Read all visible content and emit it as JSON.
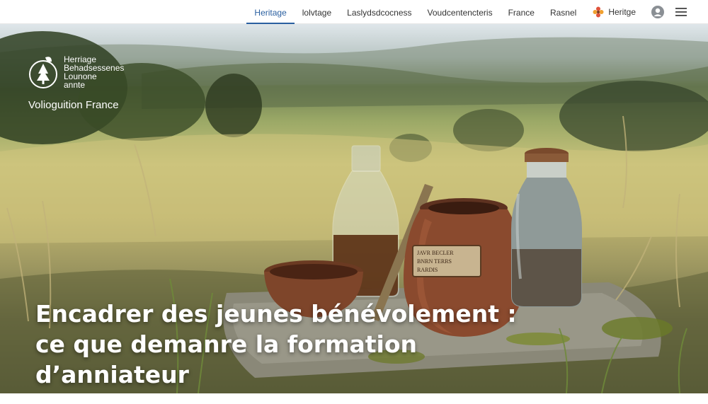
{
  "nav": {
    "items": [
      {
        "label": "Heritage",
        "active": true
      },
      {
        "label": "lolvtage"
      },
      {
        "label": "Laslydsdcocness"
      },
      {
        "label": "Voudcentencteris"
      },
      {
        "label": "France"
      },
      {
        "label": "Rasnel"
      }
    ],
    "brand_label": "Heritge",
    "icons": [
      "flower-icon",
      "user-icon",
      "menu-icon"
    ]
  },
  "logo": {
    "line1": "Herriage",
    "line2": "Behadsessenes",
    "line3": "Lounone",
    "line4": "annte",
    "tagline": "Volioguition France"
  },
  "hero": {
    "headline_line1": "Encadrer des jeunes bénévolement :",
    "headline_line2": "ce que demanre la formation",
    "headline_line3": "d’anniateur",
    "jar_label_line1": "JAVR BECLER",
    "jar_label_line2": "BNRN TERRS",
    "jar_label_line3": "RARDIS"
  },
  "colors": {
    "accent": "#2a5fa0",
    "headline_text": "#ffffff",
    "flower_red": "#e0533b",
    "flower_orange": "#f0a030"
  }
}
